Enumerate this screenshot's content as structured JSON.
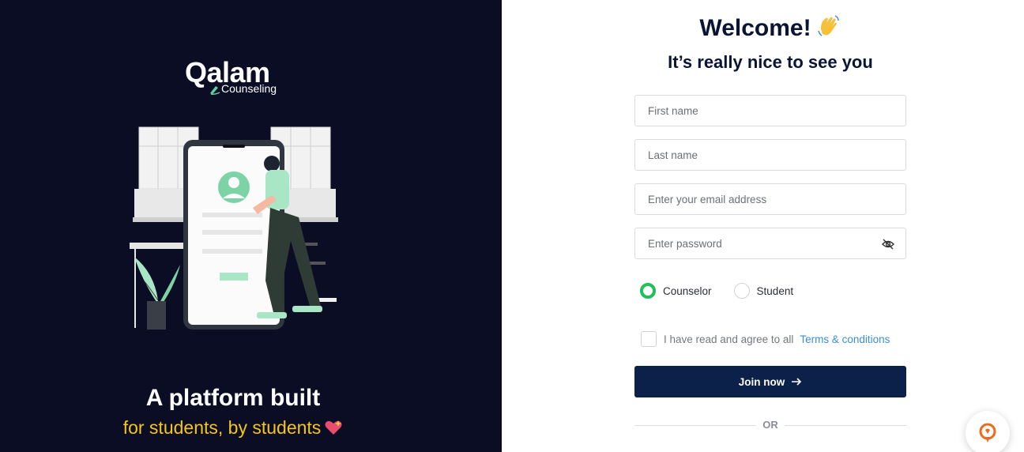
{
  "brand": {
    "name": "Qalam",
    "sub": "Counseling"
  },
  "left": {
    "tagline": "A platform built",
    "tagline2": "for students, by students",
    "bg_color": "#0b0d24",
    "accent_color": "#f5c518"
  },
  "form": {
    "title": "Welcome!",
    "subtitle": "It’s really nice to see you",
    "first_name_placeholder": "First name",
    "last_name_placeholder": "Last name",
    "email_placeholder": "Enter your email address",
    "password_placeholder": "Enter password",
    "role_options": [
      {
        "label": "Counselor",
        "selected": true
      },
      {
        "label": "Student",
        "selected": false
      }
    ],
    "agree_text": "I have read and agree to all",
    "terms_link": "Terms & conditions",
    "join_label": "Join now",
    "or_text": "OR",
    "button_color": "#0c214a",
    "radio_color": "#1fbf5b",
    "link_color": "#3b8fd6"
  },
  "icons": {
    "wave": "waving-hand-icon",
    "heart": "sparkling-heart-icon",
    "eye": "eye-off-icon",
    "arrow": "arrow-right-icon",
    "fab": "chat-support-icon"
  }
}
